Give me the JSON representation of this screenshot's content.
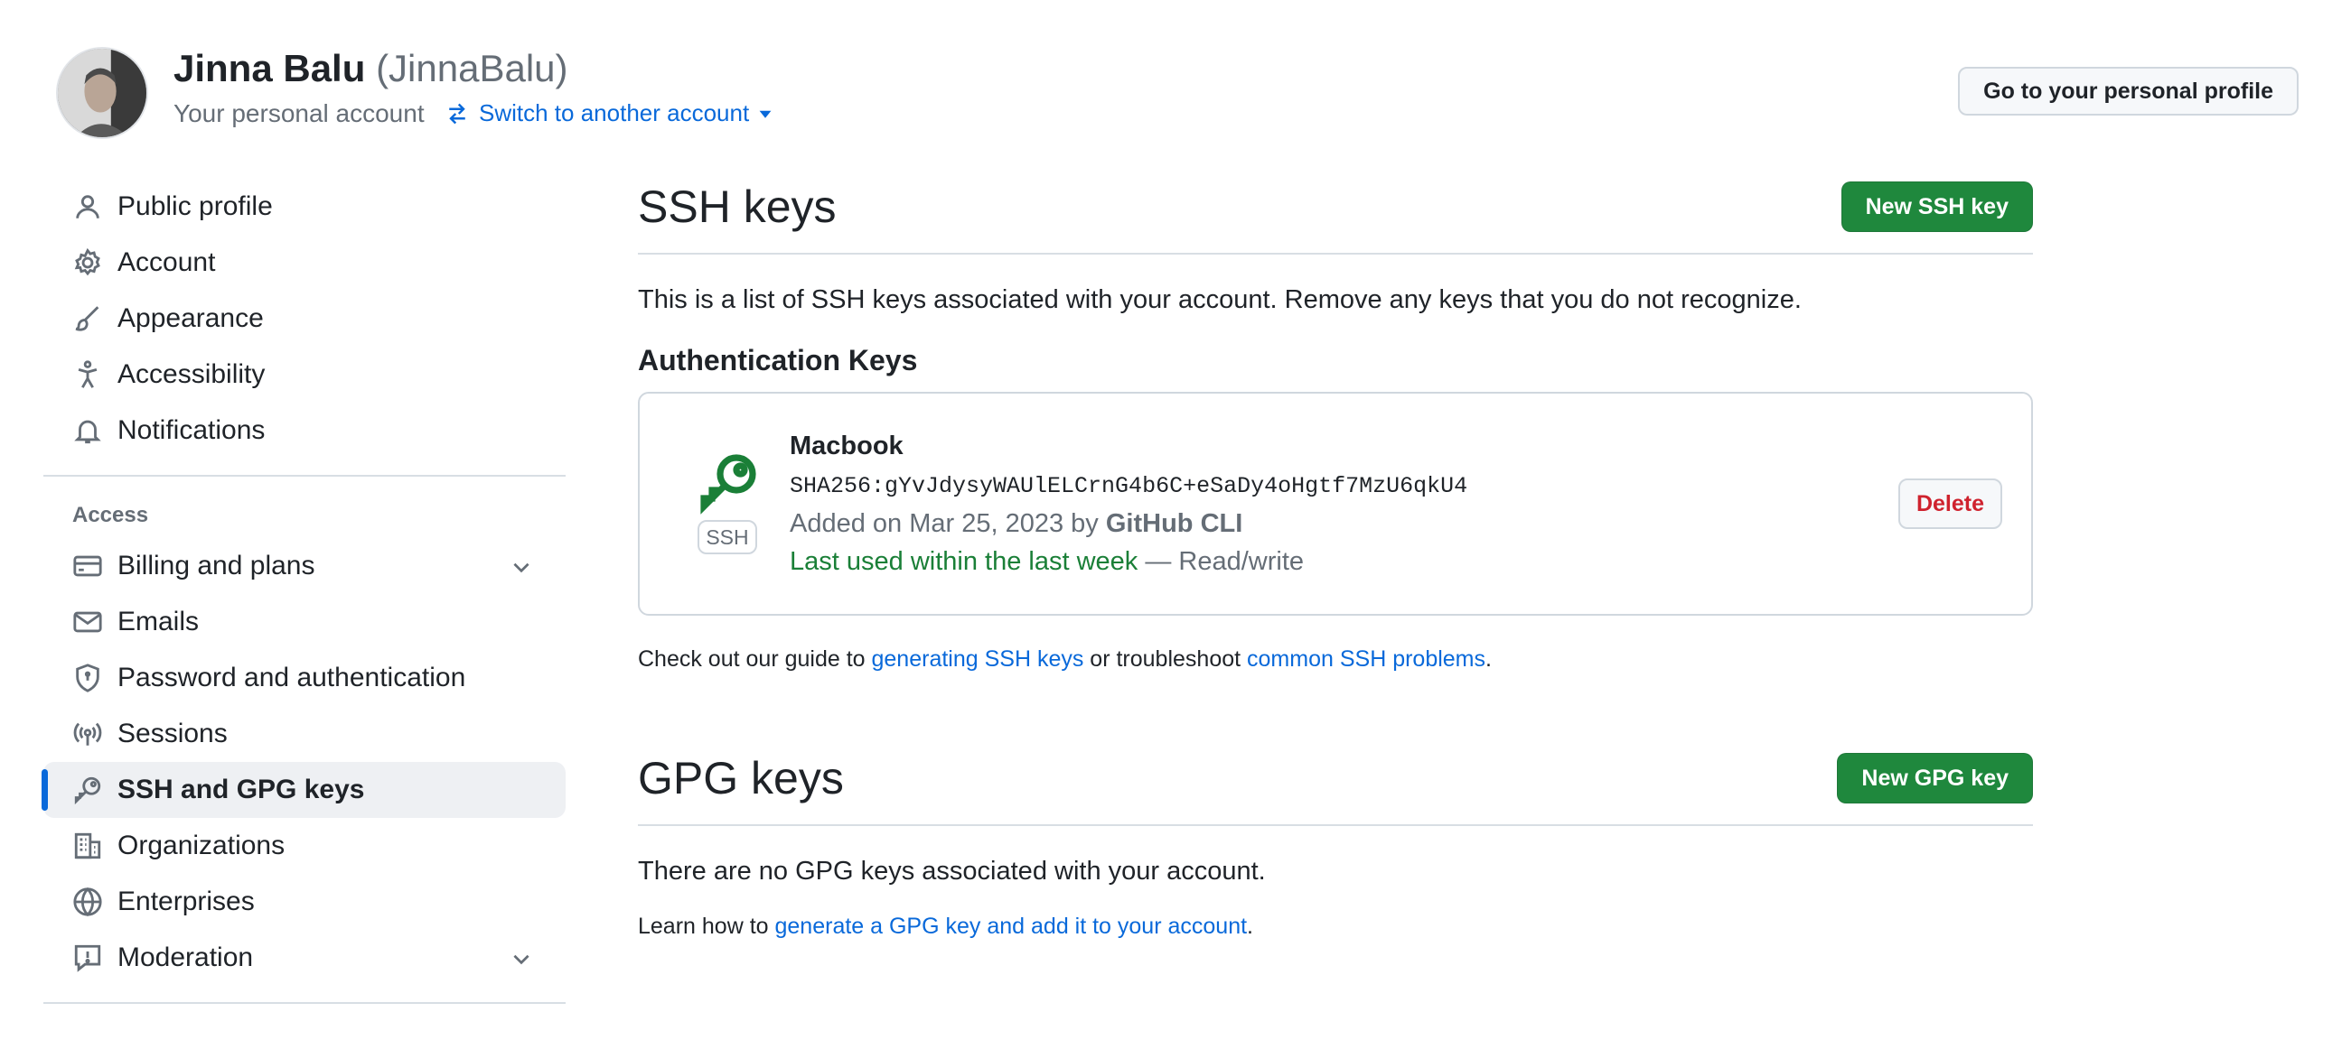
{
  "header": {
    "name": "Jinna Balu",
    "login": "(JinnaBalu)",
    "account_type": "Your personal account",
    "switch_label": "Switch to another account",
    "profile_button": "Go to your personal profile"
  },
  "sidebar": {
    "items": [
      {
        "label": "Public profile",
        "icon": "person-icon"
      },
      {
        "label": "Account",
        "icon": "gear-icon"
      },
      {
        "label": "Appearance",
        "icon": "paintbrush-icon"
      },
      {
        "label": "Accessibility",
        "icon": "accessibility-icon"
      },
      {
        "label": "Notifications",
        "icon": "bell-icon"
      }
    ],
    "access_header": "Access",
    "access_items": [
      {
        "label": "Billing and plans",
        "icon": "credit-card-icon",
        "expandable": true
      },
      {
        "label": "Emails",
        "icon": "mail-icon"
      },
      {
        "label": "Password and authentication",
        "icon": "shield-icon"
      },
      {
        "label": "Sessions",
        "icon": "broadcast-icon"
      },
      {
        "label": "SSH and GPG keys",
        "icon": "key-icon",
        "active": true
      },
      {
        "label": "Organizations",
        "icon": "organization-icon"
      },
      {
        "label": "Enterprises",
        "icon": "globe-icon"
      },
      {
        "label": "Moderation",
        "icon": "report-icon",
        "expandable": true
      }
    ]
  },
  "ssh": {
    "title": "SSH keys",
    "new_button": "New SSH key",
    "intro": "This is a list of SSH keys associated with your account. Remove any keys that you do not recognize.",
    "auth_title": "Authentication Keys",
    "key": {
      "badge": "SSH",
      "title": "Macbook",
      "fingerprint": "SHA256:gYvJdysyWAUlELCrnG4b6C+eSaDy4oHgtf7MzU6qkU4",
      "added_prefix": "Added on Mar 25, 2023 by",
      "added_by": "GitHub CLI",
      "last_used": "Last used within the last week",
      "access": " — Read/write",
      "delete_button": "Delete"
    },
    "guide_prefix": "Check out our guide to ",
    "guide_link1": "generating SSH keys",
    "guide_mid": " or troubleshoot ",
    "guide_link2": "common SSH problems",
    "guide_suffix": "."
  },
  "gpg": {
    "title": "GPG keys",
    "new_button": "New GPG key",
    "empty": "There are no GPG keys associated with your account.",
    "learn_prefix": "Learn how to ",
    "learn_link": "generate a GPG key and add it to your account",
    "learn_suffix": "."
  },
  "colors": {
    "primary_green": "#1f883d",
    "link_blue": "#0969da",
    "danger_red": "#cf222e",
    "success_green": "#1a7f37"
  }
}
